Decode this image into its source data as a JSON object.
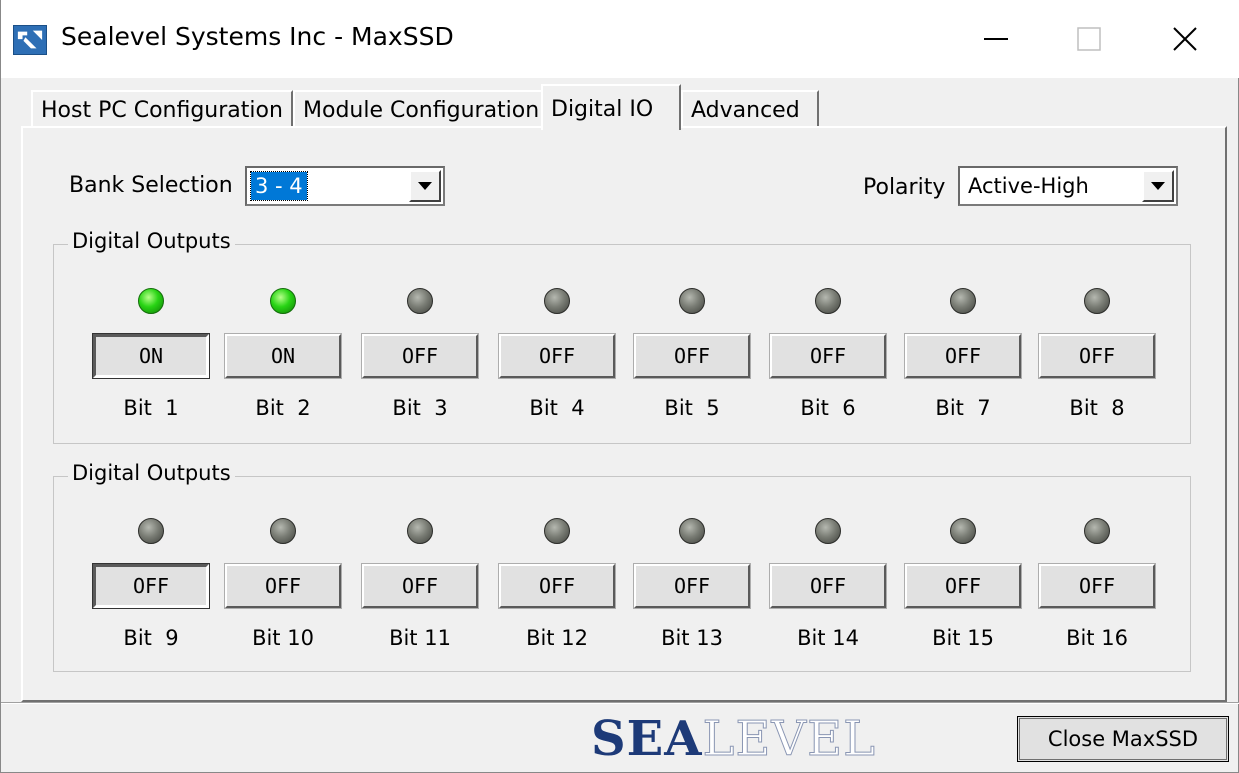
{
  "window": {
    "title": "Sealevel Systems Inc - MaxSSD"
  },
  "tabs": [
    {
      "label": "Host PC Configuration",
      "active": false
    },
    {
      "label": "Module Configuration",
      "active": false
    },
    {
      "label": "Digital IO",
      "active": true
    },
    {
      "label": "Advanced",
      "active": false
    }
  ],
  "bank": {
    "label": "Bank Selection",
    "value": "3 - 4"
  },
  "polarity": {
    "label": "Polarity",
    "value": "Active-High"
  },
  "groups": [
    {
      "title": "Digital Outputs",
      "bits": [
        {
          "label": "Bit  1",
          "state": "ON",
          "led": "on"
        },
        {
          "label": "Bit  2",
          "state": "ON",
          "led": "on"
        },
        {
          "label": "Bit  3",
          "state": "OFF",
          "led": "off"
        },
        {
          "label": "Bit  4",
          "state": "OFF",
          "led": "off"
        },
        {
          "label": "Bit  5",
          "state": "OFF",
          "led": "off"
        },
        {
          "label": "Bit  6",
          "state": "OFF",
          "led": "off"
        },
        {
          "label": "Bit  7",
          "state": "OFF",
          "led": "off"
        },
        {
          "label": "Bit  8",
          "state": "OFF",
          "led": "off"
        }
      ]
    },
    {
      "title": "Digital Outputs",
      "bits": [
        {
          "label": "Bit  9",
          "state": "OFF",
          "led": "off"
        },
        {
          "label": "Bit 10",
          "state": "OFF",
          "led": "off"
        },
        {
          "label": "Bit 11",
          "state": "OFF",
          "led": "off"
        },
        {
          "label": "Bit 12",
          "state": "OFF",
          "led": "off"
        },
        {
          "label": "Bit 13",
          "state": "OFF",
          "led": "off"
        },
        {
          "label": "Bit 14",
          "state": "OFF",
          "led": "off"
        },
        {
          "label": "Bit 15",
          "state": "OFF",
          "led": "off"
        },
        {
          "label": "Bit 16",
          "state": "OFF",
          "led": "off"
        }
      ]
    }
  ],
  "footer": {
    "logo_text_bold": "SEA",
    "logo_text_outline": "LEVEL",
    "close_label": "Close MaxSSD"
  },
  "icons": {
    "app": "sealevel-app-icon",
    "minimize": "minimize-icon",
    "maximize": "maximize-icon",
    "close": "close-icon",
    "dropdown": "chevron-down-icon"
  },
  "colors": {
    "led_on": "#28d414",
    "led_off": "#7a7d75",
    "selection": "#0078d7",
    "logo": "#1d3a78"
  }
}
